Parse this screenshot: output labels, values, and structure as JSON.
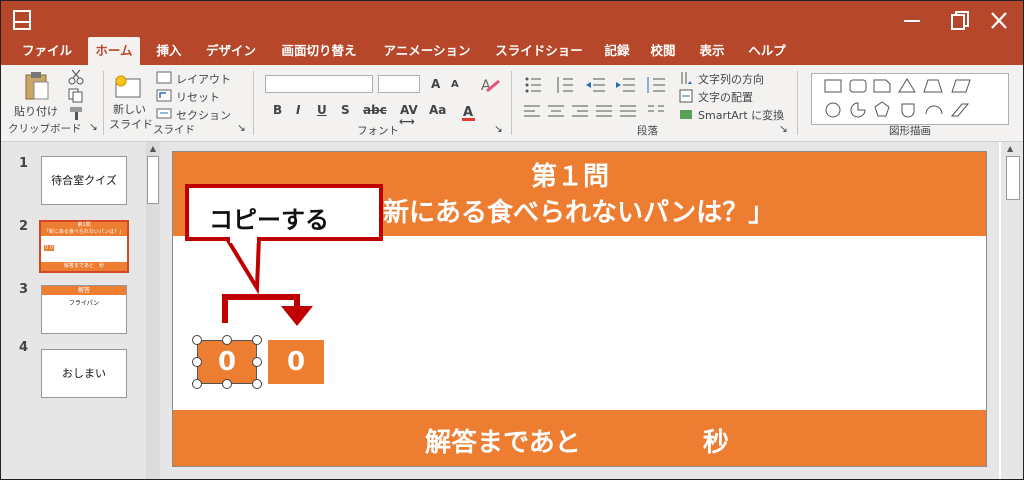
{
  "tabs": [
    "ファイル",
    "ホーム",
    "挿入",
    "デザイン",
    "画面切り替え",
    "アニメーション",
    "スライドショー",
    "記録",
    "校閲",
    "表示",
    "ヘルプ"
  ],
  "active_tab": "ホーム",
  "ribbon": {
    "clipboard": {
      "paste_label": "貼り付け",
      "group_label": "クリップボード"
    },
    "slides": {
      "new_slide_line1": "新しい",
      "new_slide_line2": "スライド",
      "layout_label": "レイアウト",
      "reset_label": "リセット",
      "section_label": "セクション",
      "group_label": "スライド"
    },
    "font": {
      "name_value": "",
      "size_value": "",
      "grow_label": "A",
      "shrink_label": "A",
      "bold_label": "B",
      "italic_label": "I",
      "underline_label": "U",
      "shadow_label": "S",
      "strike_label": "abc",
      "spacing_label": "AV",
      "case_label": "Aa",
      "group_label": "フォント"
    },
    "paragraph": {
      "text_direction_label": "文字列の方向",
      "align_text_label": "文字の配置",
      "smartart_label": "SmartArt に変換",
      "group_label": "段落"
    },
    "drawing": {
      "group_label": "図形描画"
    }
  },
  "thumbnails": [
    {
      "number": "1",
      "title": "待合室クイズ"
    },
    {
      "number": "2",
      "title": "第1問",
      "subtitle": "「新にある食べられないパンは？」",
      "mini_counter": "0 0",
      "mini_footer": "解答まであと　秒"
    },
    {
      "number": "3",
      "title": "解答",
      "subtitle": "フライパン"
    },
    {
      "number": "4",
      "title": "おしまい"
    }
  ],
  "slide": {
    "title_line1": "第１問",
    "title_line2": "新にある食べられないパンは？」",
    "counter_selected": "0",
    "counter_copy": "0",
    "footer_left": "解答まであと",
    "footer_right": "秒"
  },
  "callout": {
    "text": "コピーする"
  },
  "colors": {
    "accent": "#b7472a",
    "orange": "#ed7d31",
    "callout_red": "#c00000"
  }
}
